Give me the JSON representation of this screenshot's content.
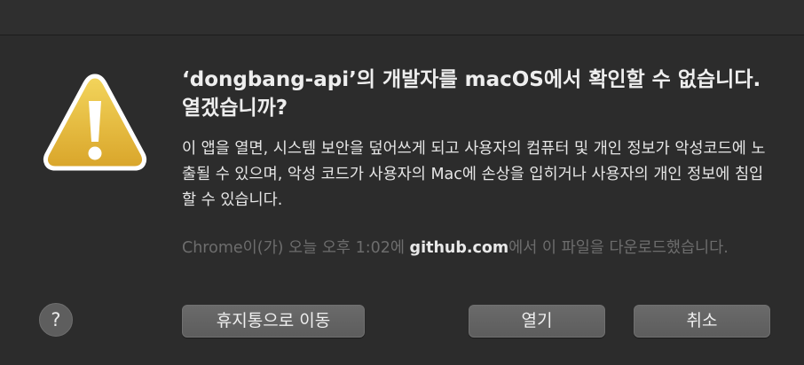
{
  "dialog": {
    "title": "‘dongbang-api’의 개발자를 macOS에서 확인할 수 없습니다. 열겠습니까?",
    "body": "이 앱을 열면, 시스템 보안을 덮어쓰게 되고 사용자의 컴퓨터 및 개인 정보가 악성코드에 노출될 수 있으며, 악성 코드가 사용자의 Mac에 손상을 입히거나 사용자의 개인 정보에 침입할 수 있습니다.",
    "source_prefix": "Chrome이(가) 오늘 오후 1:02에 ",
    "source_domain": "github.com",
    "source_suffix": "에서 이 파일을 다운로드했습니다.",
    "help_label": "?",
    "buttons": {
      "move_to_trash": "휴지통으로 이동",
      "open": "열기",
      "cancel": "취소"
    }
  },
  "icons": {
    "warning": "warning-triangle-icon"
  },
  "colors": {
    "background": "#2c2c2c",
    "warning_fill": "#e8bc3c",
    "button": "#636363",
    "muted_text": "#6d6d6d"
  }
}
